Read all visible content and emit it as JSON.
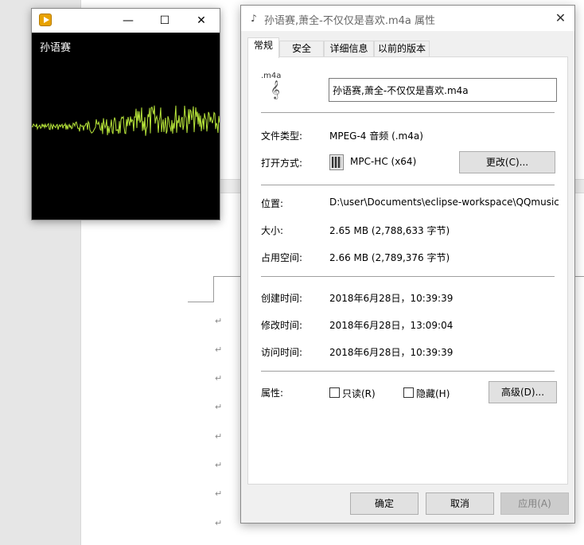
{
  "player": {
    "track_title": "孙语赛",
    "icon": "media-player-icon",
    "minimize_icon": "—",
    "maximize_icon": "☐",
    "close_icon": "✕"
  },
  "dialog": {
    "title": "孙语赛,萧全-不仅仅是喜欢.m4a 属性",
    "close_icon": "✕",
    "tabs": [
      {
        "label": "常规"
      },
      {
        "label": "安全"
      },
      {
        "label": "详细信息"
      },
      {
        "label": "以前的版本"
      }
    ],
    "file_icon_ext": ".m4a",
    "filename": "孙语赛,萧全-不仅仅是喜欢.m4a",
    "file_type": {
      "label": "文件类型:",
      "value": "MPEG-4 音频 (.m4a)"
    },
    "opens_with": {
      "label": "打开方式:",
      "app": "MPC-HC (x64)",
      "change_button": "更改(C)..."
    },
    "location": {
      "label": "位置:",
      "value": "D:\\user\\Documents\\eclipse-workspace\\QQmusicD"
    },
    "size": {
      "label": "大小:",
      "value": "2.65 MB (2,788,633 字节)"
    },
    "size_on_disk": {
      "label": "占用空间:",
      "value": "2.66 MB (2,789,376 字节)"
    },
    "created": {
      "label": "创建时间:",
      "value": "2018年6月28日，10:39:39"
    },
    "modified": {
      "label": "修改时间:",
      "value": "2018年6月28日，13:09:04"
    },
    "accessed": {
      "label": "访问时间:",
      "value": "2018年6月28日，10:39:39"
    },
    "attributes": {
      "label": "属性:",
      "readonly": {
        "label": "只读(R)",
        "checked": false
      },
      "hidden": {
        "label": "隐藏(H)",
        "checked": false
      },
      "advanced_button": "高级(D)..."
    },
    "buttons": {
      "ok": "确定",
      "cancel": "取消",
      "apply": "应用(A)"
    }
  },
  "document": {
    "paragraph_mark": "↵"
  }
}
